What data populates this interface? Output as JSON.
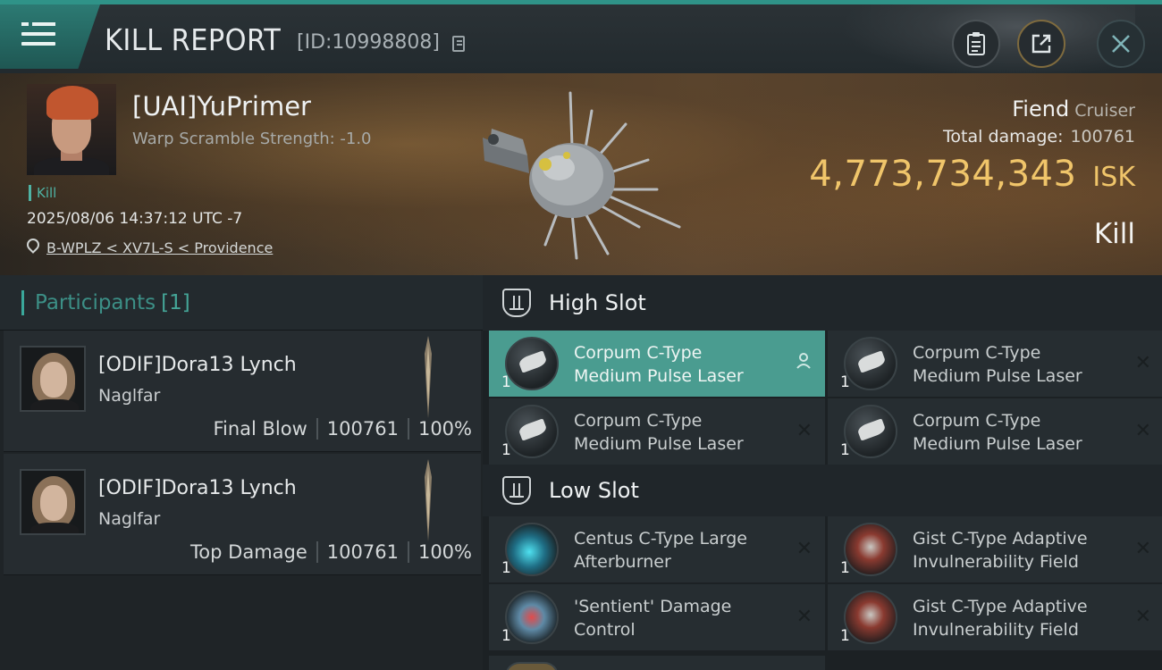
{
  "window": {
    "title": "KILL REPORT",
    "report_id": "[ID:10998808]"
  },
  "victim": {
    "name": "[UAI]YuPrimer",
    "warp_scramble": "Warp Scramble Strength: -1.0",
    "kill_tag": "Kill",
    "timestamp": "2025/08/06 14:37:12 UTC -7",
    "location": "B-WPLZ < XV7L-S < Providence"
  },
  "ship": {
    "name": "Fiend",
    "class": "Cruiser",
    "total_damage_label": "Total damage:",
    "total_damage": "100761",
    "isk_value": "4,773,734,343",
    "isk_unit": "ISK",
    "result": "Kill"
  },
  "participants": {
    "title": "Participants",
    "count": "[1]",
    "items": [
      {
        "name": "[ODIF]Dora13 Lynch",
        "ship": "Naglfar",
        "role": "Final Blow",
        "damage": "100761",
        "percent": "100%"
      },
      {
        "name": "[ODIF]Dora13 Lynch",
        "ship": "Naglfar",
        "role": "Top Damage",
        "damage": "100761",
        "percent": "100%"
      }
    ]
  },
  "fitting": {
    "high_slot": {
      "title": "High Slot",
      "modules": [
        {
          "name_line1": "Corpum C-Type",
          "name_line2": "Medium Pulse Laser",
          "qty": "1",
          "icon": "pulse-laser-icon",
          "state": "active"
        },
        {
          "name_line1": "Corpum C-Type",
          "name_line2": "Medium Pulse Laser",
          "qty": "1",
          "icon": "pulse-laser-icon",
          "state": "destroyed"
        },
        {
          "name_line1": "Corpum C-Type",
          "name_line2": "Medium Pulse Laser",
          "qty": "1",
          "icon": "pulse-laser-icon",
          "state": "destroyed"
        },
        {
          "name_line1": "Corpum C-Type",
          "name_line2": "Medium Pulse Laser",
          "qty": "1",
          "icon": "pulse-laser-icon",
          "state": "destroyed"
        }
      ]
    },
    "low_slot": {
      "title": "Low Slot",
      "modules": [
        {
          "name_line1": "Centus C-Type Large",
          "name_line2": "Afterburner",
          "qty": "1",
          "icon": "afterburner-icon",
          "state": "destroyed"
        },
        {
          "name_line1": "Gist C-Type Adaptive",
          "name_line2": "Invulnerability Field",
          "qty": "1",
          "icon": "shield-field-icon",
          "state": "destroyed"
        },
        {
          "name_line1": "'Sentient' Damage",
          "name_line2": "Control",
          "qty": "1",
          "icon": "damage-control-icon",
          "state": "destroyed"
        },
        {
          "name_line1": "Gist C-Type Adaptive",
          "name_line2": "Invulnerability Field",
          "qty": "1",
          "icon": "shield-field-icon",
          "state": "destroyed"
        }
      ]
    }
  },
  "colors": {
    "accent": "#2f9388",
    "isk_gold": "#f0c56a",
    "active_module": "#4a9c90"
  }
}
